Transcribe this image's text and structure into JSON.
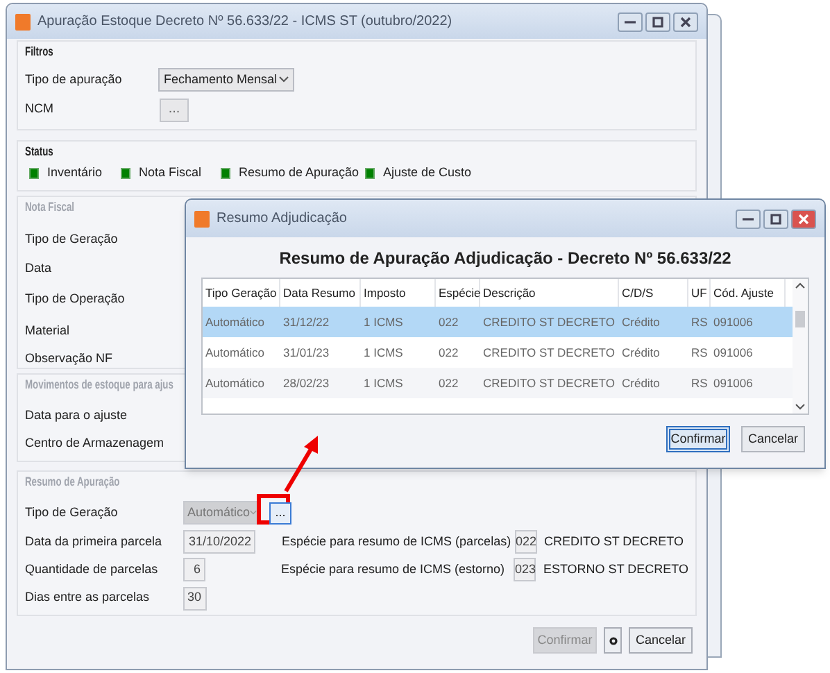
{
  "main_window": {
    "title": "Apuração Estoque Decreto Nº 56.633/22 - ICMS ST (outubro/2022)",
    "filters": {
      "title": "Filtros",
      "type_label": "Tipo de apuração",
      "type_value": "Fechamento Mensal",
      "ncm_label": "NCM",
      "ncm_button": "..."
    },
    "status": {
      "title": "Status",
      "items": [
        {
          "label": "Inventário",
          "color": "#008000"
        },
        {
          "label": "Nota Fiscal",
          "color": "#008000"
        },
        {
          "label": "Resumo de Apuração",
          "color": "#008000"
        },
        {
          "label": "Ajuste de Custo",
          "color": "#008000"
        }
      ]
    },
    "nota_fiscal": {
      "title": "Nota Fiscal",
      "disabled": true,
      "fields": [
        "Tipo de Geração",
        "Data",
        "Tipo de Operação",
        "Material",
        "Observação NF"
      ]
    },
    "movements": {
      "title": "Movimentos de estoque para ajus",
      "disabled": true,
      "fields": [
        "Data para o ajuste",
        "Centro de Armazenagem"
      ]
    },
    "summary": {
      "title": "Resumo de Apuração",
      "disabled": true,
      "generation": {
        "label": "Tipo de Geração",
        "value": "Automático",
        "disabled": true,
        "button": "..."
      },
      "first_installment": {
        "label": "Data da primeira parcela",
        "value": "31/10/2022"
      },
      "installments": {
        "label": "Quantidade de parcelas",
        "value": "6"
      },
      "days": {
        "label": "Dias entre as parcelas",
        "value": "30"
      },
      "species": [
        {
          "label": "Espécie para resumo de ICMS (parcelas)",
          "code": "022",
          "description": "CREDITO ST DECRETO"
        },
        {
          "label": "Espécie para resumo de ICMS (estorno)",
          "code": "023",
          "description": "ESTORNO ST DECRETO"
        }
      ]
    },
    "buttons": [
      {
        "kind": "text",
        "label": "Confirmar",
        "disabled": true
      },
      {
        "kind": "icon",
        "disabled": false
      },
      {
        "kind": "text",
        "label": "Cancelar",
        "disabled": false
      }
    ]
  },
  "dialog": {
    "title": "Resumo Adjudicação",
    "heading": "Resumo de Apuração Adjudicação - Decreto Nº 56.633/22",
    "table": {
      "columns": [
        "Tipo Geração",
        "Data Resumo",
        "Imposto",
        "Espécie",
        "Descrição",
        "C/D/S",
        "UF",
        "Cód. Ajuste"
      ],
      "rows": [
        {
          "selected": true,
          "cells": [
            "Automático",
            "31/12/22",
            "1 ICMS",
            "022",
            "CREDITO ST DECRETO",
            "Crédito",
            "RS",
            "091006"
          ]
        },
        {
          "selected": false,
          "cells": [
            "Automático",
            "31/01/23",
            "1 ICMS",
            "022",
            "CREDITO ST DECRETO",
            "Crédito",
            "RS",
            "091006"
          ]
        },
        {
          "selected": false,
          "cells": [
            "Automático",
            "28/02/23",
            "1 ICMS",
            "022",
            "CREDITO ST DECRETO",
            "Crédito",
            "RS",
            "091006"
          ]
        }
      ]
    },
    "buttons": [
      {
        "label": "Confirmar",
        "focused": true
      },
      {
        "label": "Cancelar",
        "focused": false
      }
    ]
  }
}
